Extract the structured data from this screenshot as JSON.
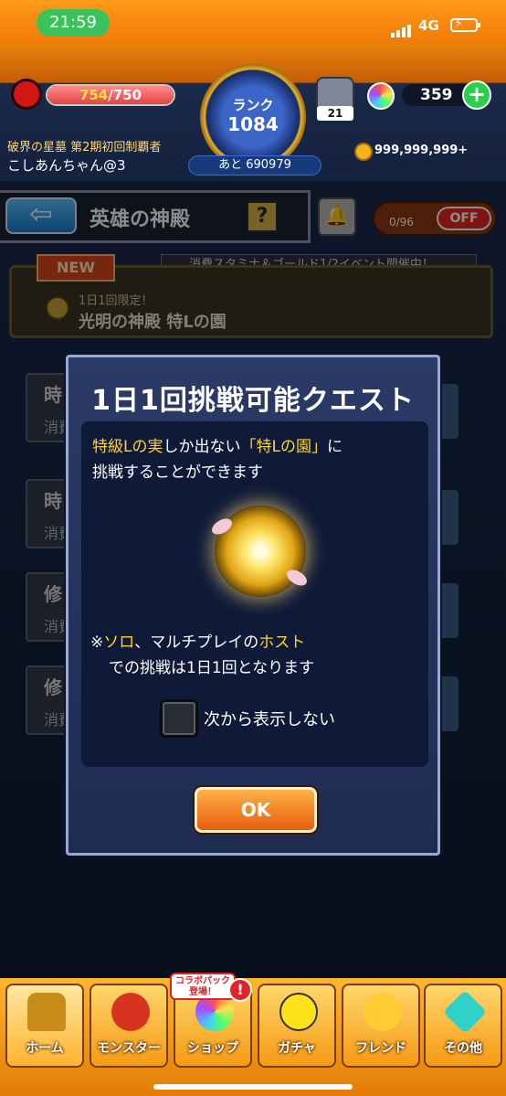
{
  "status_bar": {
    "time": "21:59",
    "network": "4G"
  },
  "hud": {
    "stamina_current": "754",
    "stamina_max": "/750",
    "stamina_fraction": 1.0,
    "rank_label": "ランク",
    "rank_value": "1084",
    "rank_next": "あと 690979",
    "level": "21",
    "orb_count": "359",
    "title": "破界の星墓 第2期初回制覇者",
    "player_name": "こしあんちゃん@3",
    "gold": "999,999,999+"
  },
  "header": {
    "title": "英雄の神殿",
    "help": "?",
    "limit_count": "0/96",
    "toggle_label": "OFF"
  },
  "event_banner": "消費スタミナ＆ゴールド1/2イベント開催中！",
  "quest": {
    "badge": "NEW",
    "subtitle": "1日1回限定！",
    "name": "光明の神殿 特Lの園"
  },
  "list_rows": [
    {
      "title": "時",
      "sub": "消費"
    },
    {
      "title": "時",
      "sub": "消費"
    },
    {
      "title": "修",
      "sub": "消費"
    },
    {
      "title": "修",
      "sub": "消費"
    }
  ],
  "modal": {
    "title": "1日1回挑戦可能クエスト",
    "msg1_part1": "特級Lの実",
    "msg1_part2": "しか出ない",
    "msg1_part3": "「特Lの園」",
    "msg1_part4": "に",
    "msg1_line2": "挑戦することができます",
    "msg2_prefix": "※",
    "msg2_solo": "ソロ",
    "msg2_mid": "、マルチプレイの",
    "msg2_host": "ホスト",
    "msg2_line2": "での挑戦は1日1回となります",
    "checkbox_label": "次から表示しない",
    "ok_label": "OK"
  },
  "nav": {
    "items": [
      {
        "label": "ホーム",
        "icon": "home-icon"
      },
      {
        "label": "モンスター",
        "icon": "monster-icon"
      },
      {
        "label": "ショップ",
        "icon": "shop-icon"
      },
      {
        "label": "ガチャ",
        "icon": "gacha-icon"
      },
      {
        "label": "フレンド",
        "icon": "friend-icon"
      },
      {
        "label": "その他",
        "icon": "other-icon"
      }
    ],
    "collab_badge_line1": "コラボパック",
    "collab_badge_line2": "登場！",
    "alert": "!"
  }
}
